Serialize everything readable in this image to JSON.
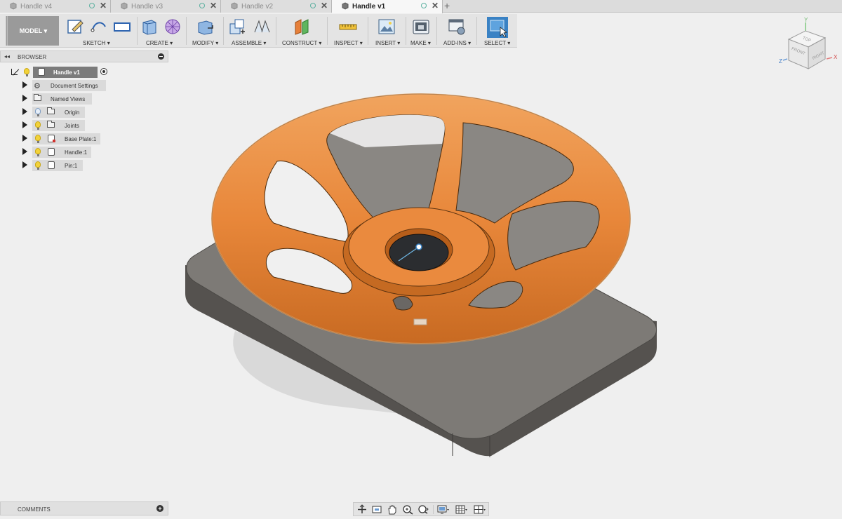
{
  "tabs": [
    {
      "label": "Handle v4",
      "active": false
    },
    {
      "label": "Handle v3",
      "active": false
    },
    {
      "label": "Handle v2",
      "active": false
    },
    {
      "label": "Handle v1",
      "active": true
    }
  ],
  "toolbar": {
    "mode_label": "MODEL",
    "groups": {
      "sketch": "SKETCH",
      "create": "CREATE",
      "modify": "MODIFY",
      "assemble": "ASSEMBLE",
      "construct": "CONSTRUCT",
      "inspect": "INSPECT",
      "insert": "INSERT",
      "make": "MAKE",
      "addins": "ADD-INS",
      "select": "SELECT"
    },
    "dropdown_glyph": "▾"
  },
  "browser": {
    "title": "BROWSER",
    "collapse_glyph": "◂◂",
    "root": "Handle v1",
    "items": [
      {
        "label": "Document Settings",
        "icon": "gear-icon"
      },
      {
        "label": "Named Views",
        "icon": "folder-icon"
      },
      {
        "label": "Origin",
        "icon": "folder-icon"
      },
      {
        "label": "Joints",
        "icon": "folder-icon"
      },
      {
        "label": "Base Plate:1",
        "icon": "component-icon"
      },
      {
        "label": "Handle:1",
        "icon": "component-icon"
      },
      {
        "label": "Pin:1",
        "icon": "component-icon"
      }
    ]
  },
  "viewcube": {
    "top": "TOP",
    "front": "FRONT",
    "right": "RIGHT",
    "axis_x": "X",
    "axis_y": "Y",
    "axis_z": "Z"
  },
  "comments": {
    "title": "COMMENTS",
    "add_glyph": "+"
  },
  "colors": {
    "accent_orange": "#ea8a3e",
    "plate_gray": "#7d7a76",
    "select_blue": "#3a82c4"
  }
}
